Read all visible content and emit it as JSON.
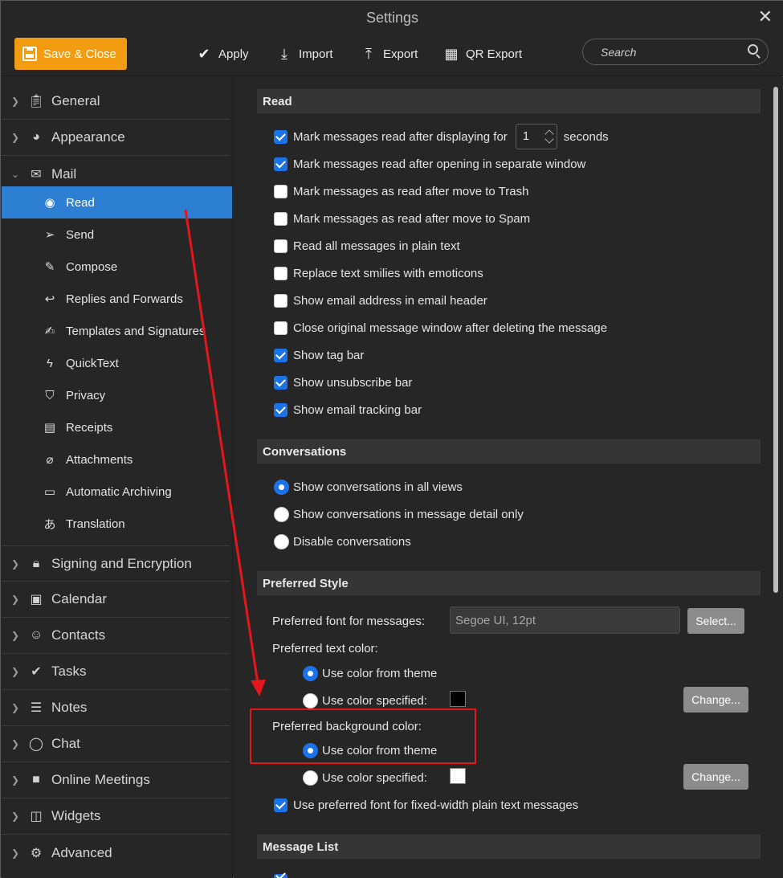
{
  "window": {
    "title": "Settings",
    "close_glyph": "✕"
  },
  "toolbar": {
    "save_label": "Save & Close",
    "apply_label": "Apply",
    "import_label": "Import",
    "export_label": "Export",
    "qr_export_label": "QR Export",
    "search_placeholder": "Search"
  },
  "sidebar": {
    "sections": [
      {
        "label": "General",
        "icon": "clipboard-icon"
      },
      {
        "label": "Appearance",
        "icon": "palette-icon"
      },
      {
        "label": "Mail",
        "icon": "envelope-icon"
      }
    ],
    "mail_items": [
      {
        "label": "Read",
        "icon": "eye-icon",
        "active": true
      },
      {
        "label": "Send",
        "icon": "paper-plane-icon"
      },
      {
        "label": "Compose",
        "icon": "pencil-icon"
      },
      {
        "label": "Replies and Forwards",
        "icon": "reply-icon"
      },
      {
        "label": "Templates and Signatures",
        "icon": "signature-icon"
      },
      {
        "label": "QuickText",
        "icon": "quicktext-icon"
      },
      {
        "label": "Privacy",
        "icon": "shield-icon"
      },
      {
        "label": "Receipts",
        "icon": "receipt-icon"
      },
      {
        "label": "Attachments",
        "icon": "paperclip-icon"
      },
      {
        "label": "Automatic Archiving",
        "icon": "archive-icon"
      },
      {
        "label": "Translation",
        "icon": "translate-icon"
      }
    ],
    "lower_sections": [
      {
        "label": "Signing and Encryption",
        "icon": "lock-icon"
      },
      {
        "label": "Calendar",
        "icon": "calendar-icon"
      },
      {
        "label": "Contacts",
        "icon": "person-icon"
      },
      {
        "label": "Tasks",
        "icon": "check-icon"
      },
      {
        "label": "Notes",
        "icon": "notes-icon"
      },
      {
        "label": "Chat",
        "icon": "chat-icon"
      },
      {
        "label": "Online Meetings",
        "icon": "video-icon"
      },
      {
        "label": "Widgets",
        "icon": "widgets-icon"
      },
      {
        "label": "Advanced",
        "icon": "gear-icon"
      }
    ]
  },
  "read": {
    "header": "Read",
    "display_prefix": "Mark messages read after displaying for",
    "display_value": "1",
    "display_suffix": "seconds",
    "options": [
      {
        "label": "Mark messages read after opening in separate window",
        "checked": true
      },
      {
        "label": "Mark messages as read after move to Trash",
        "checked": false
      },
      {
        "label": "Mark messages as read after move to Spam",
        "checked": false
      },
      {
        "label": "Read all messages in plain text",
        "checked": false
      },
      {
        "label": "Replace text smilies with emoticons",
        "checked": false
      },
      {
        "label": "Show email address in email header",
        "checked": false
      },
      {
        "label": "Close original message window after deleting the message",
        "checked": false
      },
      {
        "label": "Show tag bar",
        "checked": true
      },
      {
        "label": "Show unsubscribe bar",
        "checked": true
      },
      {
        "label": "Show email tracking bar",
        "checked": true
      }
    ]
  },
  "conversations": {
    "header": "Conversations",
    "options": [
      {
        "label": "Show conversations in all views",
        "selected": true
      },
      {
        "label": "Show conversations in message detail only",
        "selected": false
      },
      {
        "label": "Disable conversations",
        "selected": false
      }
    ]
  },
  "preferred_style": {
    "header": "Preferred Style",
    "font_label": "Preferred font for messages:",
    "font_value": "Segoe UI, 12pt",
    "select_label": "Select...",
    "text_color_label": "Preferred text color:",
    "text_use_theme": "Use color from theme",
    "text_use_specified": "Use color specified:",
    "text_swatch": "#000000",
    "bg_color_label": "Preferred background color:",
    "bg_use_theme": "Use color from theme",
    "bg_use_specified": "Use color specified:",
    "bg_swatch": "#ffffff",
    "change_label": "Change...",
    "fixed_width_label": "Use preferred font for fixed-width plain text messages"
  },
  "message_list": {
    "header": "Message List"
  },
  "colors": {
    "accent": "#f39c12",
    "selection": "#2d7fd3",
    "checkbox": "#1a73e8",
    "annotation": "#e4161b"
  }
}
